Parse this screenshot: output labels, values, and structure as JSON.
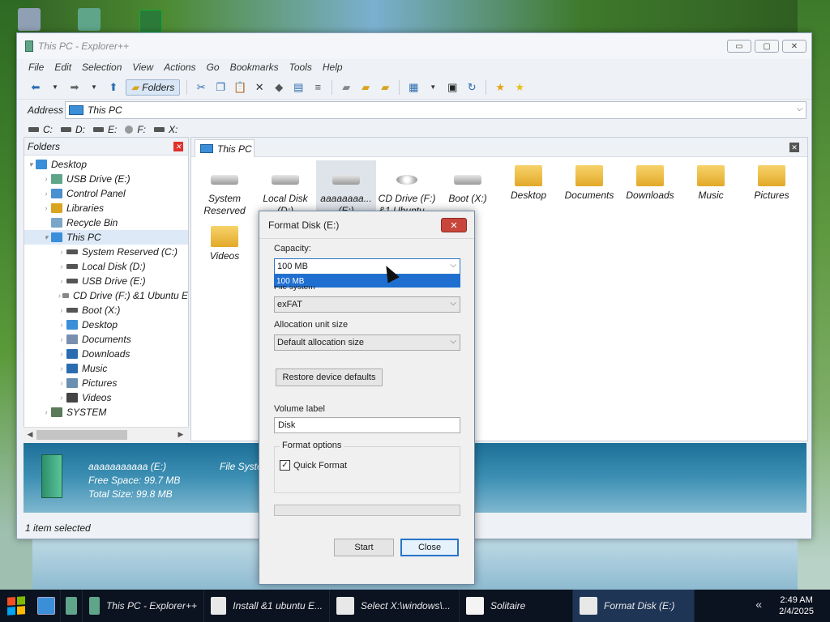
{
  "window": {
    "title": "This PC - Explorer++",
    "minimize": "▭",
    "maximize": "▢",
    "close": "✕"
  },
  "menu": [
    "File",
    "Edit",
    "Selection",
    "View",
    "Actions",
    "Go",
    "Bookmarks",
    "Tools",
    "Help"
  ],
  "toolbar": {
    "folders_label": "Folders"
  },
  "address": {
    "label": "Address",
    "value": "This PC"
  },
  "drives": [
    "C:",
    "D:",
    "E:",
    "F:",
    "X:"
  ],
  "folders_pane": {
    "title": "Folders",
    "tree": [
      {
        "label": "Desktop",
        "level": 0,
        "arrow": "▾"
      },
      {
        "label": "USB Drive (E:)",
        "level": 1,
        "arrow": "›"
      },
      {
        "label": "Control Panel",
        "level": 1,
        "arrow": "›"
      },
      {
        "label": "Libraries",
        "level": 1,
        "arrow": "›"
      },
      {
        "label": "Recycle Bin",
        "level": 1,
        "arrow": ""
      },
      {
        "label": "This PC",
        "level": 1,
        "arrow": "▾",
        "selected": true
      },
      {
        "label": "System Reserved (C:)",
        "level": 2,
        "arrow": "›"
      },
      {
        "label": "Local Disk (D:)",
        "level": 2,
        "arrow": "›"
      },
      {
        "label": "USB Drive (E:)",
        "level": 2,
        "arrow": "›"
      },
      {
        "label": "CD Drive (F:) &1 Ubuntu E",
        "level": 2,
        "arrow": "›"
      },
      {
        "label": "Boot (X:)",
        "level": 2,
        "arrow": "›"
      },
      {
        "label": "Desktop",
        "level": 2,
        "arrow": "›"
      },
      {
        "label": "Documents",
        "level": 2,
        "arrow": "›"
      },
      {
        "label": "Downloads",
        "level": 2,
        "arrow": "›"
      },
      {
        "label": "Music",
        "level": 2,
        "arrow": "›"
      },
      {
        "label": "Pictures",
        "level": 2,
        "arrow": "›"
      },
      {
        "label": "Videos",
        "level": 2,
        "arrow": "›"
      },
      {
        "label": "SYSTEM",
        "level": 1,
        "arrow": "›"
      }
    ]
  },
  "tab": {
    "label": "This PC"
  },
  "items": [
    {
      "label": "System Reserved (C:)",
      "type": "drive"
    },
    {
      "label": "Local Disk (D:)",
      "type": "drive"
    },
    {
      "label": "aaaaaaaa... (E:)",
      "type": "drive",
      "selected": true
    },
    {
      "label": "CD Drive (F:) &1 Ubuntu ...",
      "type": "cd"
    },
    {
      "label": "Boot (X:)",
      "type": "drive"
    },
    {
      "label": "Desktop",
      "type": "folder"
    },
    {
      "label": "Documents",
      "type": "folder"
    },
    {
      "label": "Downloads",
      "type": "folder"
    },
    {
      "label": "Music",
      "type": "folder"
    },
    {
      "label": "Pictures",
      "type": "folder"
    },
    {
      "label": "Videos",
      "type": "folder"
    }
  ],
  "details": {
    "name": "aaaaaaaaaaa (E:)",
    "free": "Free Space: 99.7 MB",
    "total": "Total Size: 99.8 MB",
    "fs": "File System"
  },
  "status": "1 item selected",
  "dialog": {
    "title": "Format Disk (E:)",
    "capacity_label": "Capacity:",
    "capacity_value": "100 MB",
    "capacity_option": "100 MB",
    "fs_label": "File system",
    "fs_value": "exFAT",
    "alloc_label": "Allocation unit size",
    "alloc_value": "Default allocation size",
    "restore": "Restore device defaults",
    "volume_label": "Volume label",
    "volume_value": "Disk",
    "options_label": "Format options",
    "quick_format": "Quick Format",
    "start": "Start",
    "close": "Close",
    "progress": 0
  },
  "taskbar": {
    "items": [
      {
        "label": "This PC - Explorer++"
      },
      {
        "label": "Install &1 ubuntu E..."
      },
      {
        "label": "Select X:\\windows\\..."
      },
      {
        "label": "Solitaire"
      },
      {
        "label": "Format Disk (E:)",
        "active": true
      }
    ],
    "time": "2:49 AM",
    "date": "2/4/2025"
  },
  "colors": {
    "accent": "#2a74c8",
    "close_red": "#c9463d"
  }
}
